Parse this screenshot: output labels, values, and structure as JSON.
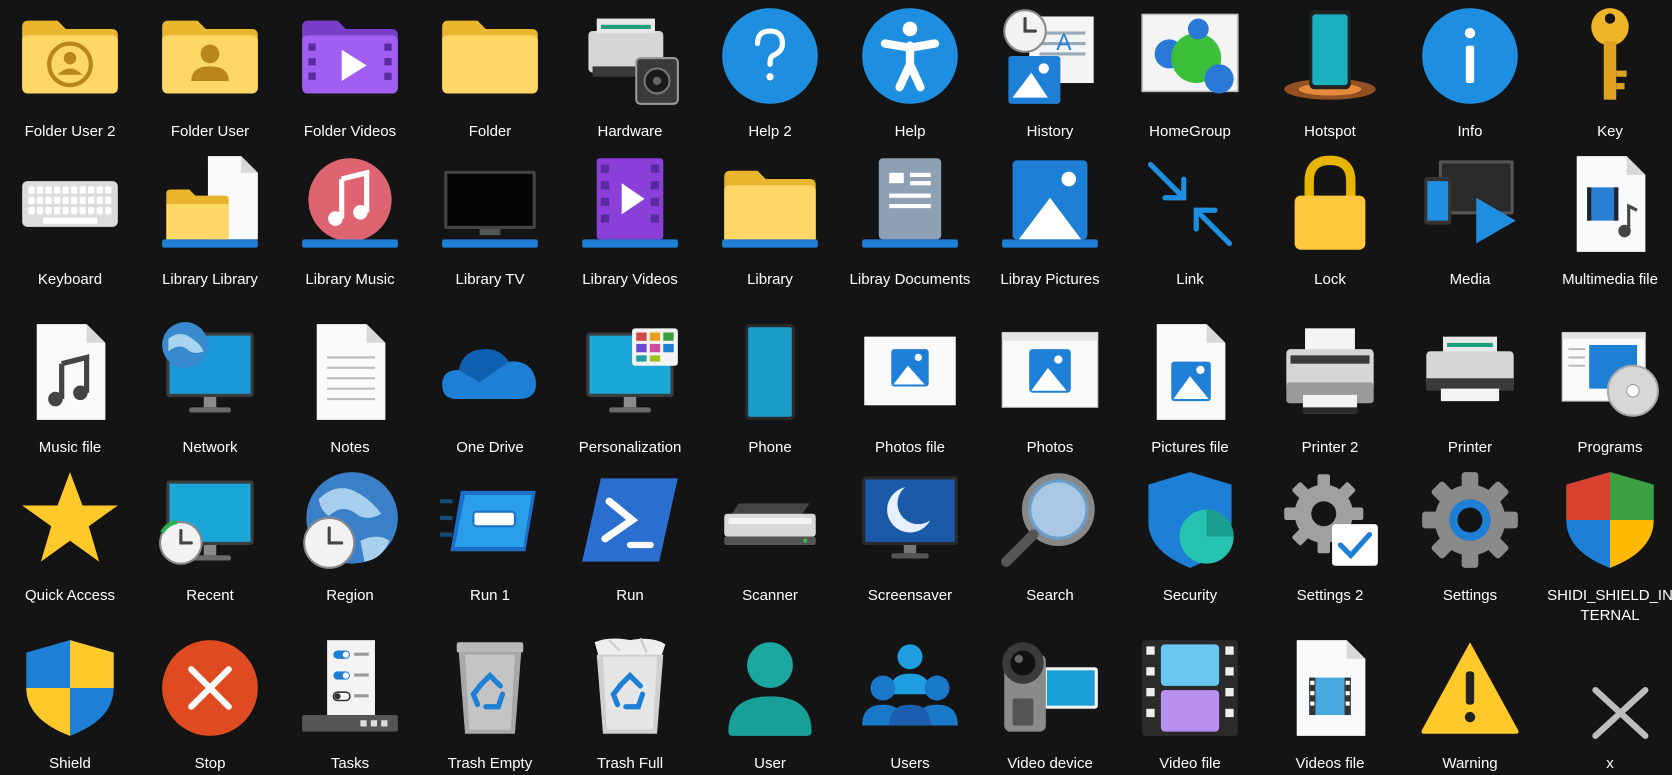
{
  "rows": [
    [
      {
        "label": "Folder User 2",
        "icon": "folder-user-2-icon"
      },
      {
        "label": "Folder User",
        "icon": "folder-user-icon"
      },
      {
        "label": "Folder Videos",
        "icon": "folder-videos-icon"
      },
      {
        "label": "Folder",
        "icon": "folder-icon"
      },
      {
        "label": "Hardware",
        "icon": "hardware-icon"
      },
      {
        "label": "Help 2",
        "icon": "help-2-icon"
      },
      {
        "label": "Help",
        "icon": "help-icon"
      },
      {
        "label": "History",
        "icon": "history-icon"
      },
      {
        "label": "HomeGroup",
        "icon": "homegroup-icon"
      },
      {
        "label": "Hotspot",
        "icon": "hotspot-icon"
      },
      {
        "label": "Info",
        "icon": "info-icon"
      },
      {
        "label": "Key",
        "icon": "key-icon"
      }
    ],
    [
      {
        "label": "Keyboard",
        "icon": "keyboard-icon"
      },
      {
        "label": "Library Library",
        "icon": "library-library-icon"
      },
      {
        "label": "Library Music",
        "icon": "library-music-icon"
      },
      {
        "label": "Library TV",
        "icon": "library-tv-icon"
      },
      {
        "label": "Library Videos",
        "icon": "library-videos-icon"
      },
      {
        "label": "Library",
        "icon": "library-icon"
      },
      {
        "label": "Libray Documents",
        "icon": "library-documents-icon"
      },
      {
        "label": "Libray Pictures",
        "icon": "library-pictures-icon"
      },
      {
        "label": "Link",
        "icon": "link-icon"
      },
      {
        "label": "Lock",
        "icon": "lock-icon"
      },
      {
        "label": "Media",
        "icon": "media-icon"
      },
      {
        "label": "Multimedia file",
        "icon": "multimedia-file-icon"
      }
    ],
    [
      {
        "label": "Music file",
        "icon": "music-file-icon"
      },
      {
        "label": "Network",
        "icon": "network-icon"
      },
      {
        "label": "Notes",
        "icon": "notes-icon"
      },
      {
        "label": "One Drive",
        "icon": "onedrive-icon"
      },
      {
        "label": "Personalization",
        "icon": "personalization-icon"
      },
      {
        "label": "Phone",
        "icon": "phone-icon"
      },
      {
        "label": "Photos file",
        "icon": "photos-file-icon"
      },
      {
        "label": "Photos",
        "icon": "photos-icon"
      },
      {
        "label": "Pictures file",
        "icon": "pictures-file-icon"
      },
      {
        "label": "Printer 2",
        "icon": "printer-2-icon"
      },
      {
        "label": "Printer",
        "icon": "printer-icon"
      },
      {
        "label": "Programs",
        "icon": "programs-icon"
      }
    ],
    [
      {
        "label": "Quick Access",
        "icon": "quick-access-icon"
      },
      {
        "label": "Recent",
        "icon": "recent-icon"
      },
      {
        "label": "Region",
        "icon": "region-icon"
      },
      {
        "label": "Run 1",
        "icon": "run-1-icon"
      },
      {
        "label": "Run",
        "icon": "run-icon"
      },
      {
        "label": "Scanner",
        "icon": "scanner-icon"
      },
      {
        "label": "Screensaver",
        "icon": "screensaver-icon"
      },
      {
        "label": "Search",
        "icon": "search-icon"
      },
      {
        "label": "Security",
        "icon": "security-icon"
      },
      {
        "label": "Settings 2",
        "icon": "settings-2-icon"
      },
      {
        "label": "Settings",
        "icon": "settings-icon"
      },
      {
        "label": "SHIDI_SHIELD_INTERNAL",
        "icon": "shield-internal-icon"
      }
    ],
    [
      {
        "label": "Shield",
        "icon": "shield-icon"
      },
      {
        "label": "Stop",
        "icon": "stop-icon"
      },
      {
        "label": "Tasks",
        "icon": "tasks-icon"
      },
      {
        "label": "Trash Empty",
        "icon": "trash-empty-icon"
      },
      {
        "label": "Trash Full",
        "icon": "trash-full-icon"
      },
      {
        "label": "User",
        "icon": "user-icon"
      },
      {
        "label": "Users",
        "icon": "users-icon"
      },
      {
        "label": "Video device",
        "icon": "video-device-icon"
      },
      {
        "label": "Video file",
        "icon": "video-file-icon"
      },
      {
        "label": "Videos file",
        "icon": "videos-file-icon"
      },
      {
        "label": "Warning",
        "icon": "warning-icon"
      },
      {
        "label": "x",
        "icon": "x-icon"
      }
    ]
  ]
}
